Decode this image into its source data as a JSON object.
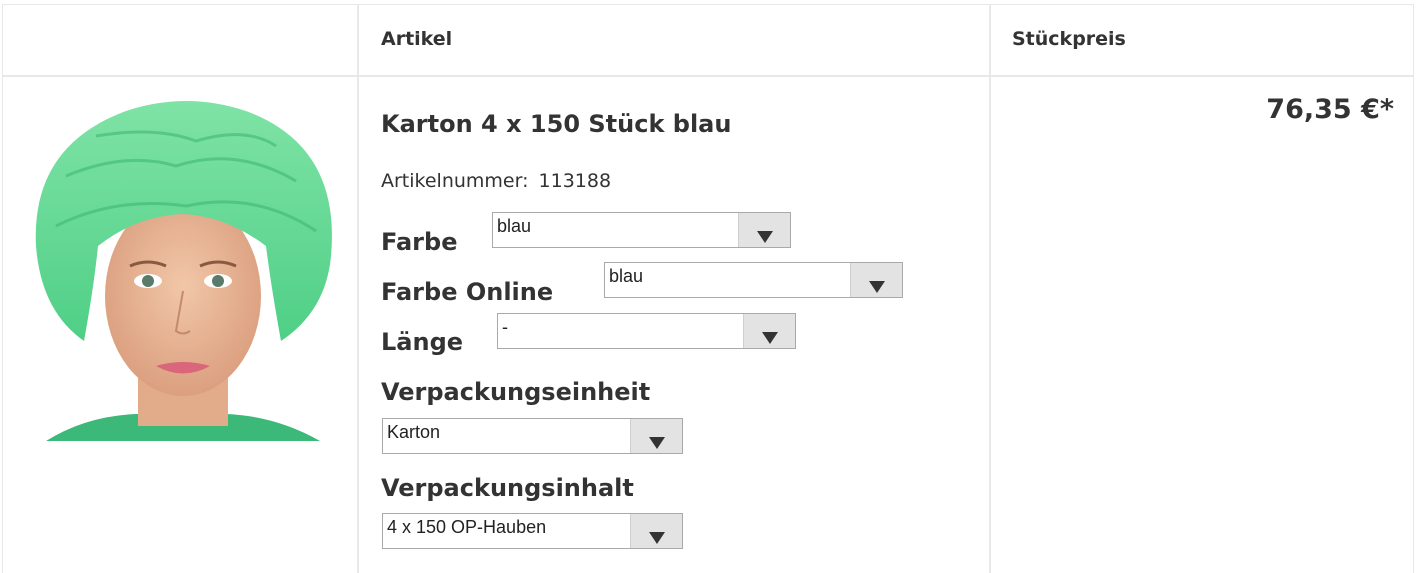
{
  "table": {
    "headers": {
      "image": "",
      "article": "Artikel",
      "unit_price": "Stückpreis"
    }
  },
  "product": {
    "title": "Karton 4 x 150 Stück blau",
    "article_number_label": "Artikelnummer:",
    "article_number": "113188",
    "price": "76,35 €*",
    "image_icon": "product-photo-woman-green-hairnet"
  },
  "options": {
    "farbe": {
      "label": "Farbe",
      "value": "blau"
    },
    "farbe_online": {
      "label": "Farbe Online",
      "value": "blau"
    },
    "laenge": {
      "label": "Länge",
      "value": "-"
    },
    "verpackungseinheit": {
      "label": "Verpackungseinheit",
      "value": "Karton"
    },
    "verpackungsinhalt": {
      "label": "Verpackungsinhalt",
      "value": "4 x 150 OP-Hauben"
    }
  },
  "colors": {
    "grid": "#e8e8e8",
    "text": "#333333",
    "net_green": "#5ed68f"
  }
}
